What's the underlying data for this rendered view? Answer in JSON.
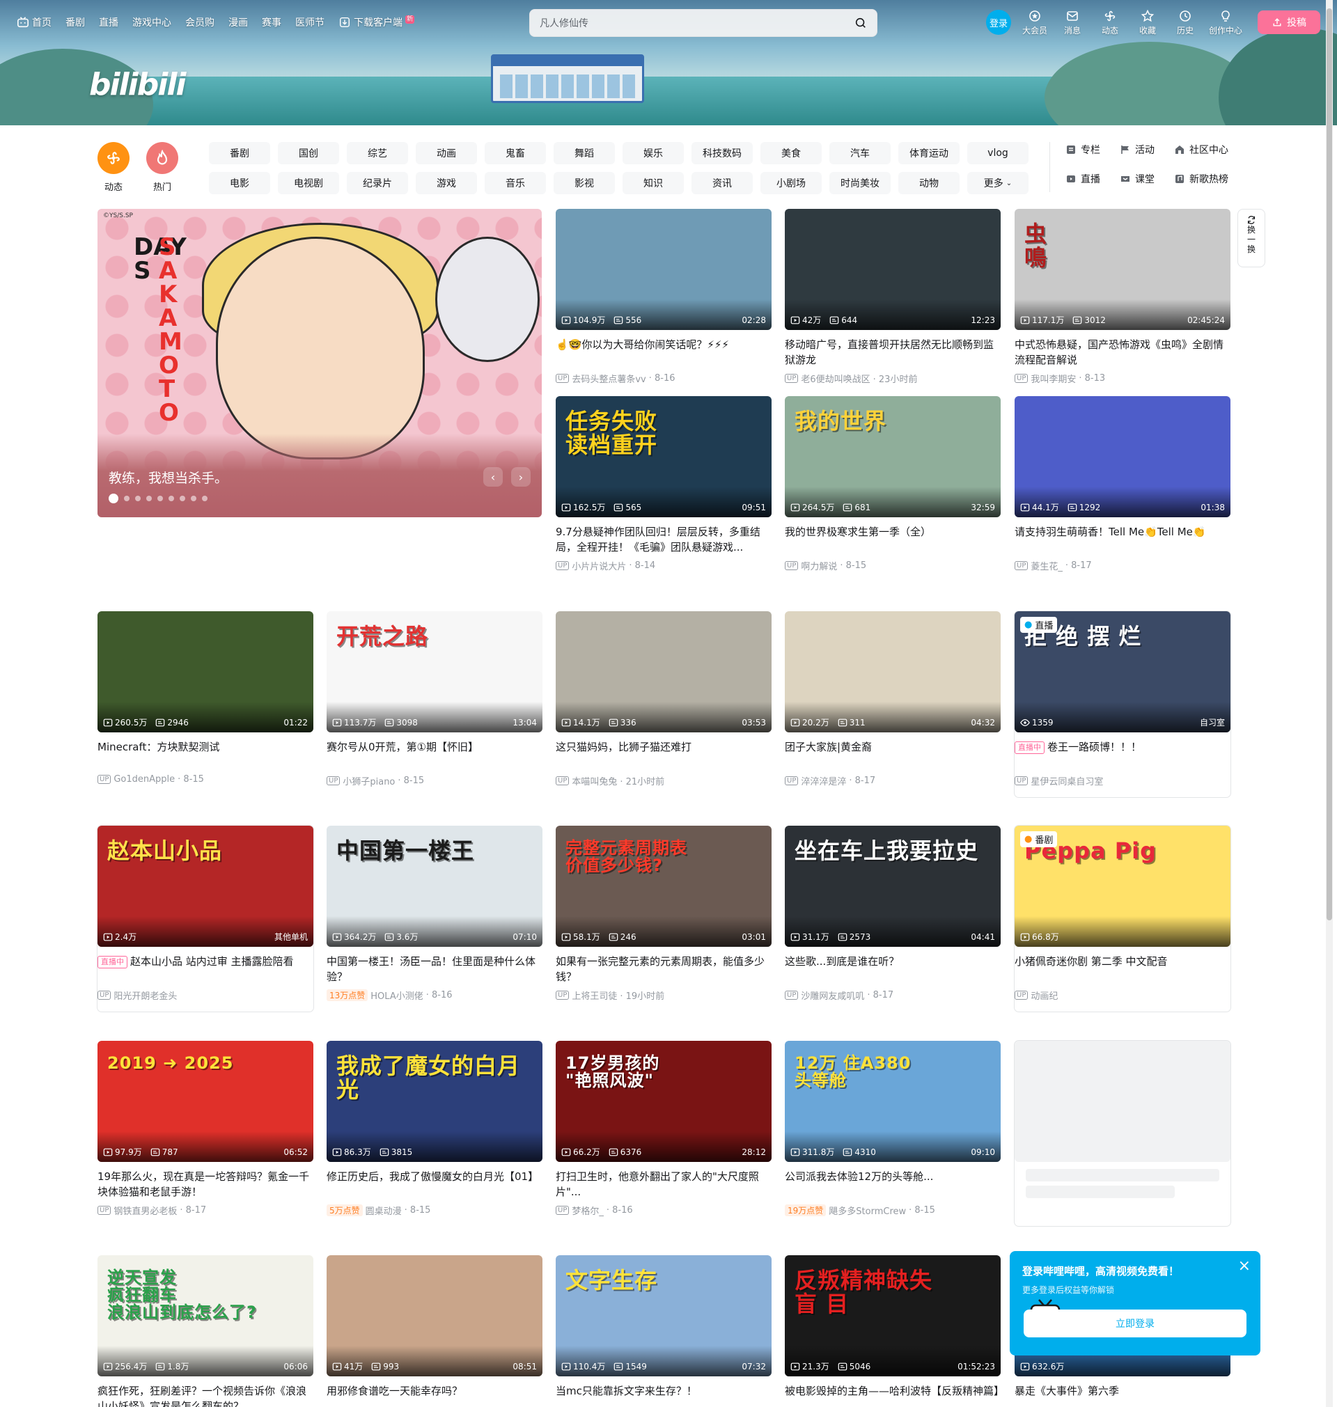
{
  "topnav": {
    "items": [
      {
        "label": "首页",
        "icon": "bilibili-tv-icon"
      },
      {
        "label": "番剧"
      },
      {
        "label": "直播"
      },
      {
        "label": "游戏中心"
      },
      {
        "label": "会员购"
      },
      {
        "label": "漫画"
      },
      {
        "label": "赛事"
      },
      {
        "label": "医师节"
      },
      {
        "label": "下载客户端",
        "icon": "download-icon",
        "badge": "新"
      }
    ],
    "search_placeholder": "凡人修仙传",
    "login": "登录",
    "right_items": [
      {
        "label": "大会员",
        "icon": "vip-icon"
      },
      {
        "label": "消息",
        "icon": "message-icon"
      },
      {
        "label": "动态",
        "icon": "dynamic-icon"
      },
      {
        "label": "收藏",
        "icon": "star-icon"
      },
      {
        "label": "历史",
        "icon": "history-icon"
      },
      {
        "label": "创作中心",
        "icon": "bulb-icon"
      }
    ],
    "upload": "投稿"
  },
  "logo": "bilibili",
  "channels": {
    "circles": [
      {
        "label": "动态",
        "color": "#ff9212"
      },
      {
        "label": "热门",
        "color": "#f07775"
      }
    ],
    "grid": [
      "番剧",
      "国创",
      "综艺",
      "动画",
      "鬼畜",
      "舞蹈",
      "娱乐",
      "科技数码",
      "美食",
      "汽车",
      "体育运动",
      "vlog",
      "电影",
      "电视剧",
      "纪录片",
      "游戏",
      "音乐",
      "影视",
      "知识",
      "资讯",
      "小剧场",
      "时尚美妆",
      "动物",
      "更多"
    ],
    "side": [
      {
        "label": "专栏",
        "icon": "column-icon"
      },
      {
        "label": "活动",
        "icon": "flag-icon"
      },
      {
        "label": "社区中心",
        "icon": "community-icon"
      },
      {
        "label": "直播",
        "icon": "live-icon"
      },
      {
        "label": "课堂",
        "icon": "class-icon"
      },
      {
        "label": "新歌热榜",
        "icon": "music-chart-icon"
      }
    ]
  },
  "carousel": {
    "copyright": "©YS/S.SP",
    "title_text_1": "DAYS",
    "title_text_2": "SAKAMOTO",
    "caption": "教练，我想当杀手。",
    "dot_count": 9
  },
  "refresh": {
    "label_1": "换",
    "label_2": "一",
    "label_3": "换"
  },
  "cards": [
    {
      "views": "104.9万",
      "danmaku": "556",
      "duration": "02:28",
      "title": "☝️🤓你以为大哥给你闹笑话呢？⚡⚡⚡",
      "author": "去码头整点薯条vv",
      "date": "8-16",
      "bg": "#6f9bb5"
    },
    {
      "views": "42万",
      "danmaku": "644",
      "duration": "12:23",
      "title": "移动暗广号，直接普坝开扶居然无比顺畅到监狱游龙",
      "author": "老6便劫叫唤战区",
      "date": "23小时前",
      "bg": "#2f3a40"
    },
    {
      "views": "117.1万",
      "danmaku": "3012",
      "duration": "02:45:24",
      "title": "中式恐怖悬疑，国产恐怖游戏《虫鸣》全剧情流程配音解说",
      "author": "我叫李期安",
      "date": "8-13",
      "bg": "#c9c9c9",
      "thumb_text": "虫\n鳴",
      "thumb_color": "#b01d1d"
    },
    {
      "views": "162.5万",
      "danmaku": "565",
      "duration": "09:51",
      "title": "9.7分悬疑神作团队回归！层层反转，多重结局，全程开挂！《毛骗》团队悬疑游戏...",
      "author": "小片片说大片",
      "date": "8-14",
      "bg": "#1f3c52",
      "thumb_text": "任务失败\n读档重开",
      "thumb_color": "#ffd21e"
    },
    {
      "views": "264.5万",
      "danmaku": "681",
      "duration": "32:59",
      "title": "我的世界极寒求生第一季（全）",
      "author": "啊力解说",
      "date": "8-15",
      "bg": "#8fae9a",
      "thumb_text": "我的世界",
      "thumb_color": "#ffd23a"
    },
    {
      "views": "44.1万",
      "danmaku": "1292",
      "duration": "01:38",
      "title": "请支持羽生萌萌香！Tell Me👏Tell Me👏",
      "author": "菱生花_",
      "date": "8-17",
      "bg": "#4e5dc9"
    },
    {
      "views": "260.5万",
      "danmaku": "2946",
      "duration": "01:22",
      "title": "Minecraft：方块默契测试",
      "author": "Go1denApple",
      "date": "8-15",
      "bg": "#3f5a2c"
    },
    {
      "views": "113.7万",
      "danmaku": "3098",
      "duration": "13:04",
      "title": "赛尔号从0开荒，第①期【怀旧】",
      "author": "小狮子piano",
      "date": "8-15",
      "bg": "#f7f7f7",
      "thumb_text": "开荒之路",
      "thumb_color": "#e23232"
    },
    {
      "views": "14.1万",
      "danmaku": "336",
      "duration": "03:53",
      "title": "这只猫妈妈，比狮子猫还难打",
      "author": "本喵叫兔兔",
      "date": "21小时前",
      "bg": "#b4b0a4"
    },
    {
      "views": "20.2万",
      "danmaku": "311",
      "duration": "04:32",
      "title": "团子大家族|黄金裔",
      "author": "淬淬淬是淬",
      "date": "8-17",
      "bg": "#ddd4c0"
    },
    {
      "live_viewers": "1359",
      "live_area": "自习室",
      "title": "卷王一路硕博！！！",
      "live_badge": "直播中",
      "author": "星伊云同桌自习室",
      "corner": "直播",
      "bg": "#3b4a66",
      "thumb_text": "拒 绝 摆 烂",
      "thumb_color": "#ffffff"
    },
    {
      "views": "2.4万",
      "live_area": "其他单机",
      "title": "赵本山小品 站内过审 主播露脸陪看",
      "live_badge": "直播中",
      "author": "阳光开朗老金头",
      "bg": "#b42626",
      "thumb_text": "赵本山小品",
      "thumb_color": "#ffe14a"
    },
    {
      "views": "364.2万",
      "danmaku": "3.6万",
      "duration": "07:10",
      "title": "中国第一楼王！汤臣一品！住里面是种什么体验？",
      "likes": "13万点赞",
      "author": "HOLA小测佬",
      "date": "8-16",
      "bg": "#dfe6ea",
      "thumb_text": "中国第一楼王",
      "thumb_color": "#1b1b1b"
    },
    {
      "views": "58.1万",
      "danmaku": "246",
      "duration": "03:01",
      "title": "如果有一张完整元素的元素周期表，能值多少钱？",
      "author": "上将王司徒",
      "date": "19小时前",
      "bg": "#6b5a52",
      "thumb_text": "完整元素周期表\n价值多少钱?",
      "thumb_color": "#ff3a2a"
    },
    {
      "views": "31.1万",
      "danmaku": "2573",
      "duration": "04:41",
      "title": "这些歌...到底是谁在听？",
      "author": "沙雕网友咸叽叽",
      "date": "8-17",
      "bg": "#2c3136",
      "thumb_text": "坐在车上我要拉史",
      "thumb_color": "#ffffff"
    },
    {
      "views": "66.8万",
      "title": "小猪佩奇迷你剧 第二季 中文配音",
      "author": "动画纪",
      "corner": "番剧",
      "bg": "#ffe169",
      "thumb_text": "Peppa Pig",
      "thumb_color": "#e8283a"
    },
    {
      "views": "97.9万",
      "danmaku": "787",
      "duration": "06:52",
      "title": "19年那么火，现在真是一坨答辩吗？氪金一千块体验猫和老鼠手游！",
      "author": "钢铁直男必老板",
      "date": "8-17",
      "bg": "#e0302a",
      "thumb_text": "2019 ➜ 2025",
      "thumb_color": "#ffe23a"
    },
    {
      "views": "86.3万",
      "danmaku": "3815",
      "duration": "",
      "title": "修正历史后，我成了傲慢魔女的白月光【01】",
      "likes": "5万点赞",
      "author": "圆桌动漫",
      "date": "8-15",
      "bg": "#2c3f7a",
      "thumb_text": "我成了魔女的白月光",
      "thumb_color": "#ffe23a"
    },
    {
      "views": "66.2万",
      "danmaku": "6376",
      "duration": "28:12",
      "title": "打扫卫生时，他意外翻出了家人的\"大尺度照片\"...",
      "author": "梦格尔_",
      "date": "8-16",
      "bg": "#7a1414",
      "thumb_text": "17岁男孩的\n\"艳照风波\"",
      "thumb_color": "#ffffff"
    },
    {
      "views": "311.8万",
      "danmaku": "4310",
      "duration": "09:10",
      "title": "公司派我去体验12万的头等舱...",
      "likes": "19万点赞",
      "author": "飓多多StormCrew",
      "date": "8-15",
      "bg": "#6aa6d8",
      "thumb_text": "12万 住A380\n头等舱",
      "thumb_color": "#ffe23a"
    },
    {
      "views": "256.4万",
      "danmaku": "1.8万",
      "duration": "06:06",
      "title": "疯狂作死，狂刷差评？一个视频告诉你《浪浪山小妖怪》宣发是怎么翻车的？",
      "bg": "#f2f2ea",
      "thumb_text": "逆天宣发\n疯狂翻车\n浪浪山到底怎么了?",
      "thumb_color": "#2aa14a"
    },
    {
      "views": "41万",
      "danmaku": "993",
      "duration": "08:51",
      "title": "用邪修食谱吃一天能幸存吗？",
      "bg": "#c9a58a"
    },
    {
      "views": "110.4万",
      "danmaku": "1549",
      "duration": "07:32",
      "title": "当mc只能靠拆文字来生存？！",
      "bg": "#8ab0d8",
      "thumb_text": "文字生存",
      "thumb_color": "#ffe23a"
    },
    {
      "views": "21.3万",
      "danmaku": "5046",
      "duration": "01:52:23",
      "title": "被电影毁掉的主角——哈利波特【反叛精神篇】",
      "bg": "#1a1a1a",
      "thumb_text": "反叛精神缺失\n盲 目",
      "thumb_color": "#e42020"
    },
    {
      "views": "632.6万",
      "title": "暴走《大事件》第六季",
      "bg": "#2e6fb0"
    }
  ],
  "popup": {
    "title": "登录哔哩哔哩，高清视频免费看！",
    "subtitle": "更多登录后权益等你解锁",
    "button": "立即登录"
  }
}
